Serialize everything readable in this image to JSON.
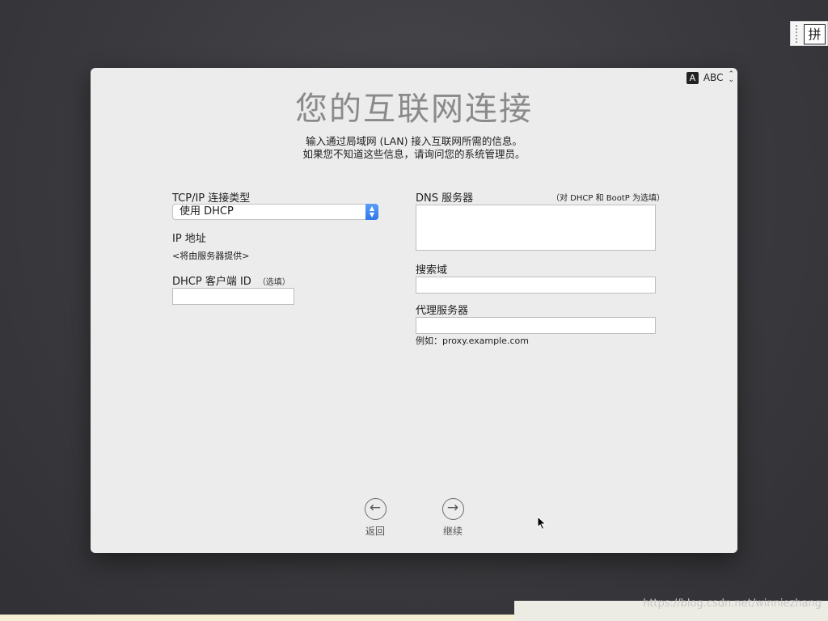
{
  "ime": {
    "glyph": "拼"
  },
  "input_source": {
    "badge": "A",
    "label": "ABC",
    "chevron_up": "⌃",
    "chevron_down": "⌄"
  },
  "title": "您的互联网连接",
  "subtitle": [
    "输入通过局域网 (LAN) 接入互联网所需的信息。",
    "如果您不知道这些信息，请询问您的系统管理员。"
  ],
  "left": {
    "tcp_label": "TCP/IP 连接类型",
    "tcp_value": "使用 DHCP",
    "ip_label": "IP 地址",
    "ip_value": "<将由服务器提供>",
    "dhcp_label": "DHCP 客户端 ID",
    "dhcp_optional": "（选填）",
    "dhcp_value": ""
  },
  "right": {
    "dns_label": "DNS 服务器",
    "dns_note": "（对 DHCP 和 BootP 为选填）",
    "dns_value": "",
    "search_label": "搜索域",
    "search_value": "",
    "proxy_label": "代理服务器",
    "proxy_value": "",
    "proxy_example": "例如：proxy.example.com"
  },
  "nav": {
    "back_label": "返回",
    "back_icon": "←",
    "continue_label": "继续",
    "continue_icon": "→"
  },
  "watermark": "https://blog.csdn.net/winniezhang"
}
